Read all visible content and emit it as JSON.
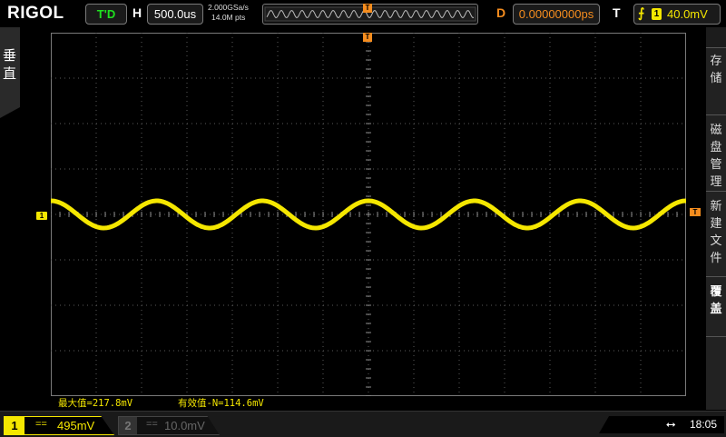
{
  "topbar": {
    "logo": "RIGOL",
    "run_state": "T'D",
    "horizontal_tag": "H",
    "timebase": "500.0us",
    "sample_rate": "2.000GSa/s",
    "memory_depth": "14.0M pts",
    "delay_tag": "D",
    "delay": "0.00000000ps",
    "trigger_tag": "T",
    "trigger_source": "1",
    "trigger_level": "40.0mV",
    "trigger_slope_icon": "rising-edge-icon"
  },
  "left_menu": {
    "label": "垂直"
  },
  "right_menu": {
    "items": [
      {
        "label": "存储"
      },
      {
        "label": "磁盘管理"
      },
      {
        "label": "新建文件"
      },
      {
        "label": "覆盖"
      }
    ]
  },
  "markers": {
    "channel_1": "1",
    "trigger_level": "T",
    "trigger_position": "T"
  },
  "waveform": {
    "channel": "1",
    "color": "#f5e700",
    "cycles_on_screen": 6,
    "amplitude_div": 0.3,
    "offset_div": 0.0
  },
  "measurements": [
    {
      "label": "最大值=217.8mV"
    },
    {
      "label": "有效值-N=114.6mV"
    }
  ],
  "bottombar": {
    "ch1": {
      "number": "1",
      "coupling": "==",
      "scale": "495mV",
      "active": true
    },
    "ch2": {
      "number": "2",
      "coupling": "==",
      "scale": "10.0mV",
      "active": false
    },
    "usb_icon": "usb-icon",
    "time": "18:05"
  },
  "colors": {
    "ch1": "#f5e700",
    "trigger": "#f68d1e",
    "run_state": "#1fe01f",
    "grid": "#5a5a5a"
  }
}
